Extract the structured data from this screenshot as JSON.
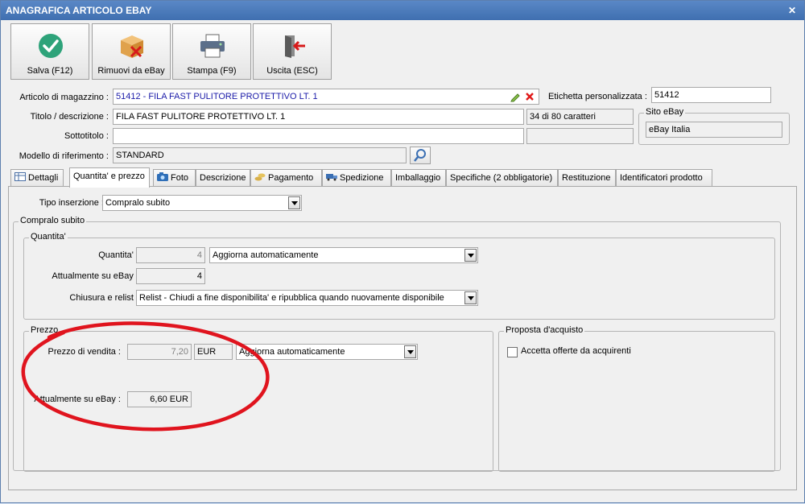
{
  "window": {
    "title": "ANAGRAFICA ARTICOLO EBAY",
    "close_glyph": "✕"
  },
  "toolbar": {
    "buttons": [
      {
        "label": "Salva (F12)",
        "icon": "checkmark-icon"
      },
      {
        "label": "Rimuovi da eBay",
        "icon": "box-remove-icon"
      },
      {
        "label": "Stampa (F9)",
        "icon": "printer-icon"
      },
      {
        "label": "Uscita (ESC)",
        "icon": "exit-door-icon"
      }
    ]
  },
  "form": {
    "articolo_label": "Articolo di magazzino :",
    "articolo_value": "51412 - FILA FAST PULITORE PROTETTIVO LT. 1",
    "etichetta_label": "Etichetta personalizzata :",
    "etichetta_value": "51412",
    "titolo_label": "Titolo / descrizione :",
    "titolo_value": "FILA FAST PULITORE PROTETTIVO LT. 1",
    "char_count": "34 di 80 caratteri",
    "sottotitolo_label": "Sottotitolo :",
    "sottotitolo_value": "",
    "modello_label": "Modello di riferimento :",
    "modello_value": "STANDARD",
    "sito_title": "Sito eBay",
    "sito_value": "eBay Italia"
  },
  "tabs": [
    {
      "label": "Dettagli",
      "icon": "table-icon"
    },
    {
      "label": "Quantita' e prezzo",
      "icon": ""
    },
    {
      "label": "Foto",
      "icon": "camera-icon"
    },
    {
      "label": "Descrizione",
      "icon": ""
    },
    {
      "label": "Pagamento",
      "icon": "coins-icon"
    },
    {
      "label": "Spedizione",
      "icon": "truck-icon"
    },
    {
      "label": "Imballaggio",
      "icon": ""
    },
    {
      "label": "Specifiche (2 obbligatorie)",
      "icon": ""
    },
    {
      "label": "Restituzione",
      "icon": ""
    },
    {
      "label": "Identificatori prodotto",
      "icon": ""
    }
  ],
  "active_tab": "Quantita' e prezzo",
  "page": {
    "tipo_label": "Tipo inserzione :",
    "tipo_value": "Compralo subito",
    "compralo_group": "Compralo subito",
    "quantita_group": "Quantita'",
    "quantita_label": "Quantita' :",
    "quantita_value": "4",
    "quantita_mode": "Aggiorna automaticamente",
    "attuale_qty_label": "Attualmente su eBay :",
    "attuale_qty_value": "4",
    "chiusura_label": "Chiusura e relist :",
    "chiusura_value": "Relist - Chiudi a fine disponibilita' e ripubblica quando nuovamente disponibile",
    "prezzo_group": "Prezzo",
    "prezzo_label": "Prezzo di vendita :",
    "prezzo_value": "7,20",
    "prezzo_currency": "EUR",
    "prezzo_mode": "Aggiorna automaticamente",
    "attuale_prezzo_label": "Attualmente su eBay :",
    "attuale_prezzo_value": "6,60 EUR",
    "proposta_group": "Proposta d'acquisto",
    "proposta_check_label": "Accetta offerte da acquirenti",
    "proposta_checked": false
  },
  "colors": {
    "annotation_red": "#e0141e",
    "titlebar": "#4a7cbd",
    "link_blue": "#1a1aa8"
  }
}
